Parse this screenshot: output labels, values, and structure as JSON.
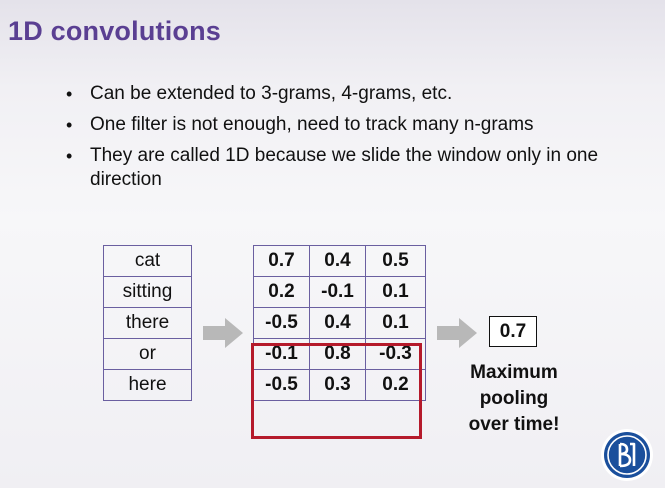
{
  "slide": {
    "title": "1D convolutions",
    "bullets": [
      "Can be extended to 3-grams, 4-grams, etc.",
      "One filter is not enough, need to track many n-grams",
      "They are called 1D because we slide the window only in one direction"
    ]
  },
  "words": [
    "cat",
    "sitting",
    "there",
    "or",
    "here"
  ],
  "matrix": {
    "rows": [
      [
        "0.7",
        "0.4",
        "0.5"
      ],
      [
        "0.2",
        "-0.1",
        "0.1"
      ],
      [
        "-0.5",
        "0.4",
        "0.1"
      ],
      [
        "-0.1",
        "0.8",
        "-0.3"
      ],
      [
        "-0.5",
        "0.3",
        "0.2"
      ]
    ]
  },
  "pooling": {
    "result": "0.7",
    "caption_lines": [
      "Maximum",
      "pooling",
      "over time!"
    ]
  },
  "colors": {
    "title": "#5a3f92",
    "grid_border": "#6a5fa0",
    "window_highlight": "#b51a2b",
    "arrow": "#b8b8b8",
    "logo": "#1a4f9c"
  },
  "icons": [
    "right-arrow-icon",
    "hse-logo-icon"
  ]
}
